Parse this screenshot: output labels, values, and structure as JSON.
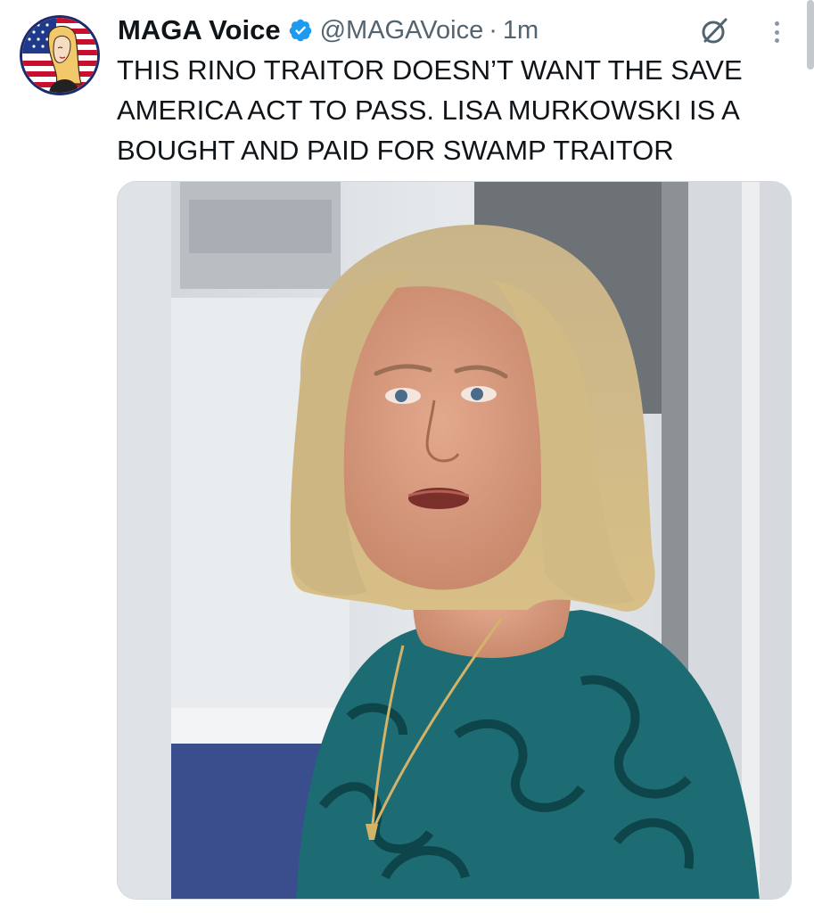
{
  "author": {
    "name": "MAGA Voice",
    "handle": "@MAGAVoice",
    "separator": "·",
    "timestamp": "1m",
    "verified": true,
    "avatar_icon": "woman-flag-avatar"
  },
  "tweet": {
    "text": "THIS RINO TRAITOR DOESN’T WANT THE SAVE\nAMERICA ACT TO PASS. LISA MURKOWSKI IS A\nBOUGHT AND PAID FOR SWAMP TRAITOR"
  },
  "media": {
    "type": "photo",
    "subject": "woman-portrait"
  },
  "icons": {
    "verified": "verified-badge-icon",
    "grok": "grok-icon",
    "more": "more-options-icon"
  },
  "colors": {
    "verified_blue": "#1d9bf0",
    "text_primary": "#0f1419",
    "text_secondary": "#536471"
  }
}
